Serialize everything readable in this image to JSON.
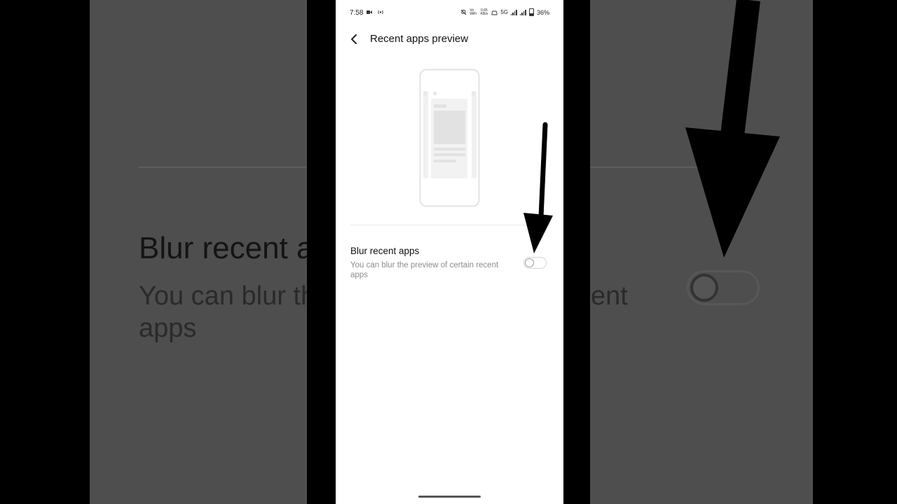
{
  "status_bar": {
    "time": "7:58",
    "left_icons": [
      "video-camera-icon",
      "hotspot-icon"
    ],
    "net_speed": "0.65 KB/s",
    "network": "5G",
    "vo_label": "Vo WiFi",
    "battery": "36%",
    "right_icons": [
      "mute-bell-icon",
      "volte-icon",
      "net-speed-icon",
      "car-icon",
      "network-5g-icon",
      "signal-icon",
      "signal-icon",
      "battery-icon"
    ]
  },
  "header": {
    "title": "Recent apps preview",
    "back_icon": "chevron-left-icon"
  },
  "setting": {
    "title": "Blur recent apps",
    "description": "You can blur the preview of certain recent apps",
    "toggle_on": false
  },
  "background_zoom": {
    "title": "Blur recent apps",
    "description": "You can blur the preview of certain recent apps"
  },
  "colors": {
    "arrow": "#000000",
    "background_dim": "#4e4e4e",
    "text_primary": "#111111",
    "text_secondary": "#8c8c8c"
  }
}
